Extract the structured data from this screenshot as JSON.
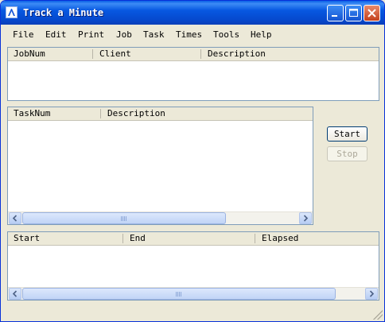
{
  "window": {
    "title": "Track a Minute"
  },
  "menu": [
    "File",
    "Edit",
    "Print",
    "Job",
    "Task",
    "Times",
    "Tools",
    "Help"
  ],
  "job_panel": {
    "columns": [
      "JobNum",
      "Client",
      "Description"
    ]
  },
  "task_panel": {
    "columns": [
      "TaskNum",
      "Description"
    ]
  },
  "time_panel": {
    "columns": [
      "Start",
      "End",
      "Elapsed"
    ]
  },
  "buttons": {
    "start": "Start",
    "stop": "Stop"
  },
  "colors": {
    "titlebar": "#0758e1",
    "face": "#ece9d8",
    "border": "#7f9db9"
  }
}
